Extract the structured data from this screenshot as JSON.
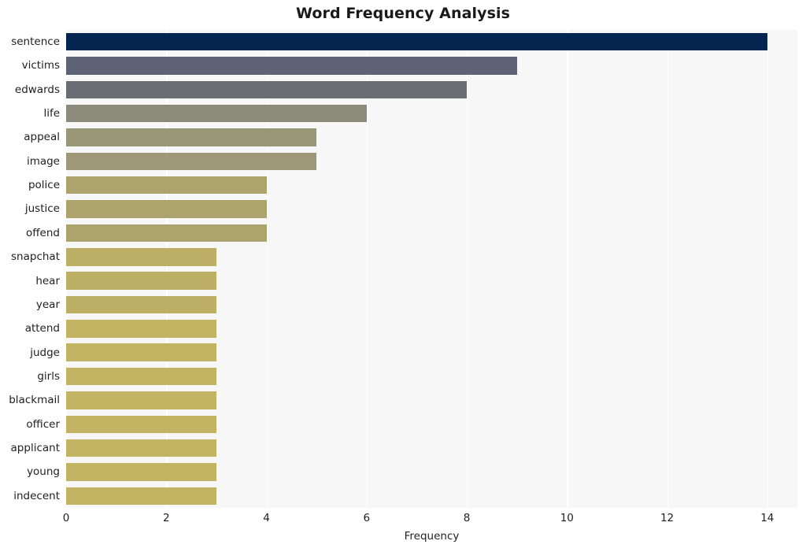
{
  "chart_data": {
    "type": "bar",
    "orientation": "horizontal",
    "title": "Word Frequency Analysis",
    "xlabel": "Frequency",
    "ylabel": "",
    "categories": [
      "sentence",
      "victims",
      "edwards",
      "life",
      "appeal",
      "image",
      "police",
      "justice",
      "offend",
      "snapchat",
      "hear",
      "year",
      "attend",
      "judge",
      "girls",
      "blackmail",
      "officer",
      "applicant",
      "young",
      "indecent"
    ],
    "values": [
      14,
      9,
      8,
      6,
      5,
      5,
      4,
      4,
      4,
      3,
      3,
      3,
      3,
      3,
      3,
      3,
      3,
      3,
      3,
      3
    ],
    "bar_colors": [
      "#04254f",
      "#5d6375",
      "#6b6d75",
      "#8c8a7a",
      "#9a9678",
      "#9e9878",
      "#aca46c",
      "#aca46c",
      "#aca46c",
      "#bdb066",
      "#bdb066",
      "#bdb066",
      "#c2b463",
      "#c2b463",
      "#c2b463",
      "#c2b463",
      "#c2b463",
      "#c2b463",
      "#c2b463",
      "#c2b463"
    ],
    "xlim": [
      0,
      14.6
    ],
    "xticks": [
      0,
      2,
      4,
      6,
      8,
      10,
      12,
      14
    ],
    "xtick_labels": [
      "0",
      "2",
      "4",
      "6",
      "8",
      "10",
      "12",
      "14"
    ],
    "grid": true,
    "grid_axis": "x",
    "grid_color": "#ffffff",
    "plot_background": "#f7f7f7",
    "figure_background": "#ffffff",
    "legend": null
  }
}
